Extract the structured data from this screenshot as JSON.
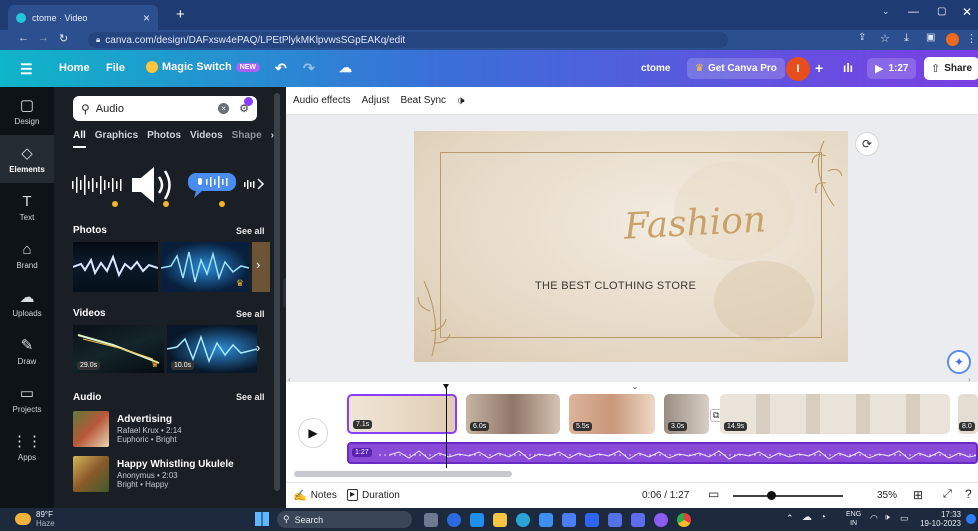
{
  "browser": {
    "tab_title": "ctome · Video",
    "tab_close": "×",
    "new_tab": "+",
    "url": "canva.com/design/DAFxsw4ePAQ/LPEtPlykMKlpvwsSGpEAKq/edit"
  },
  "topbar": {
    "home": "Home",
    "file": "File",
    "magic_switch": "Magic Switch",
    "new_badge": "NEW",
    "doc_name": "ctome",
    "get_pro": "Get Canva Pro",
    "avatar_letter": "I",
    "play_time": "1:27",
    "share": "Share"
  },
  "rail": {
    "items": [
      {
        "label": "Design",
        "icon": "▢"
      },
      {
        "label": "Elements",
        "icon": "◇"
      },
      {
        "label": "Text",
        "icon": "T"
      },
      {
        "label": "Brand",
        "icon": "⌂"
      },
      {
        "label": "Uploads",
        "icon": "☁"
      },
      {
        "label": "Draw",
        "icon": "✎"
      },
      {
        "label": "Projects",
        "icon": "▭"
      },
      {
        "label": "Apps",
        "icon": "⋮⋮"
      }
    ]
  },
  "panel": {
    "search_value": "Audio",
    "tabs": [
      "All",
      "Graphics",
      "Photos",
      "Videos",
      "Shape"
    ],
    "photos_title": "Photos",
    "videos_title": "Videos",
    "audio_title": "Audio",
    "see_all": "See all",
    "video_durations": [
      "29.0s",
      "10.0s"
    ],
    "audio_tracks": [
      {
        "title": "Advertising",
        "meta1": "Rafael Krux • 2:14",
        "meta2": "Euphoric • Bright"
      },
      {
        "title": "Happy Whistling Ukulele",
        "meta1": "Anonymus • 2:03",
        "meta2": "Bright • Happy"
      }
    ]
  },
  "ctxbar": {
    "audio_effects": "Audio effects",
    "adjust": "Adjust",
    "beat_sync": "Beat Sync"
  },
  "slide": {
    "title": "Fashion",
    "subtitle": "THE BEST CLOTHING STORE"
  },
  "timeline": {
    "clips": [
      "7.1s",
      "6.0s",
      "5.5s",
      "3.0s",
      "14.9s",
      "8.0"
    ],
    "audio_label": "1:27"
  },
  "bottom": {
    "notes": "Notes",
    "duration": "Duration",
    "time": "0:06 / 1:27",
    "zoom": "35%",
    "zoom_level": 0.35
  },
  "taskbar": {
    "weather_temp": "89°F",
    "weather_desc": "Haze",
    "search": "Search",
    "lang1": "ENG",
    "lang2": "IN",
    "time": "17:33",
    "date": "19-10-2023"
  },
  "colors": {
    "accent": "#8b3dff",
    "topbar_gradient": [
      "#0fb5c8",
      "#7b3fe4"
    ],
    "panel_bg": "#1a1f26",
    "audio_track": "#8a4bd8"
  }
}
